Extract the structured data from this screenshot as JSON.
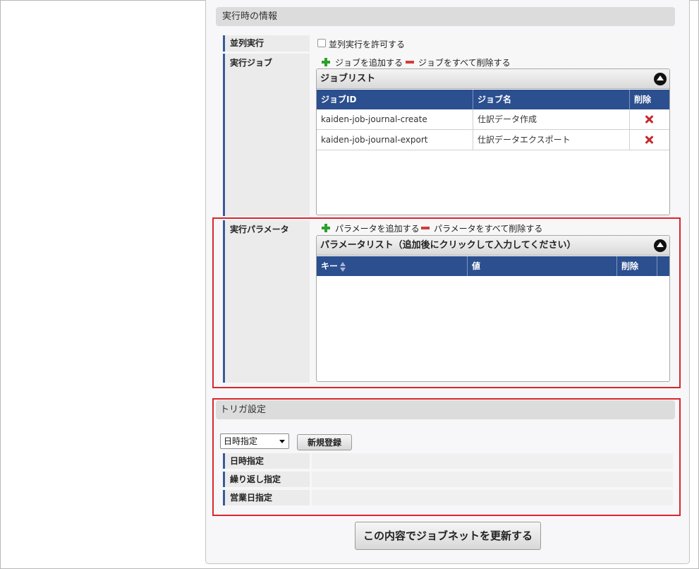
{
  "runtime_section": {
    "title": "実行時の情報"
  },
  "parallel": {
    "label": "並列実行",
    "checkbox_label": "並列実行を許可する",
    "checked": false
  },
  "jobs": {
    "label": "実行ジョブ",
    "add_label": "ジョブを追加する",
    "delete_all_label": "ジョブをすべて削除する",
    "grid_title": "ジョブリスト",
    "columns": [
      "ジョブID",
      "ジョブ名",
      "削除"
    ],
    "rows": [
      {
        "id": "kaiden-job-journal-create",
        "name": "仕訳データ作成"
      },
      {
        "id": "kaiden-job-journal-export",
        "name": "仕訳データエクスポート"
      }
    ]
  },
  "params": {
    "label": "実行パラメータ",
    "add_label": "パラメータを追加する",
    "delete_all_label": "パラメータをすべて削除する",
    "grid_title": "パラメータリスト（追加後にクリックして入力してください）",
    "columns": [
      "キー",
      "値",
      "削除"
    ]
  },
  "trigger": {
    "title": "トリガ設定",
    "select_value": "日時指定",
    "register_button": "新規登録",
    "rows": [
      "日時指定",
      "繰り返し指定",
      "営業日指定"
    ]
  },
  "submit_button": "この内容でジョブネットを更新する",
  "colors": {
    "header_blue": "#2b4f8f",
    "highlight_red": "#d9262d",
    "add_green": "#2ea02e",
    "delete_red": "#c8282d"
  }
}
